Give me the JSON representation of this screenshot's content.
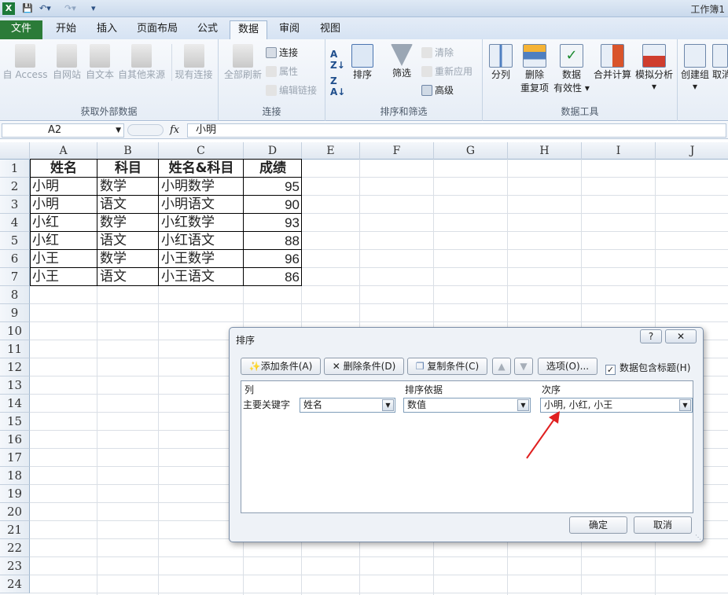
{
  "titlebar": {
    "icons": [
      "excel-logo-icon",
      "save-icon",
      "undo-icon",
      "redo-icon",
      "customize-icon"
    ],
    "title": "工作簿1"
  },
  "tabs": [
    "文件",
    "开始",
    "插入",
    "页面布局",
    "公式",
    "数据",
    "审阅",
    "视图"
  ],
  "active_tab": "数据",
  "ribbon": {
    "groups": {
      "external": {
        "label": "获取外部数据",
        "buttons": [
          "自 Access",
          "自网站",
          "自文本",
          "自其他来源",
          "现有连接"
        ]
      },
      "connections": {
        "label": "连接",
        "refresh_all": "全部刷新",
        "items": [
          "连接",
          "属性",
          "编辑链接"
        ]
      },
      "sort_filter": {
        "label": "排序和筛选",
        "sort": "排序",
        "filter": "筛选",
        "items": [
          "清除",
          "重新应用",
          "高级"
        ]
      },
      "data_tools": {
        "label": "数据工具",
        "buttons": [
          "分列",
          "删除",
          "重复项",
          "数据",
          "有效性",
          "合并计算",
          "模拟分析"
        ]
      },
      "outline": {
        "buttons": [
          "创建组",
          "取消"
        ]
      }
    }
  },
  "formula_bar": {
    "name_box": "A2",
    "fx_label": "fx",
    "value": "小明"
  },
  "sheet": {
    "columns": [
      "A",
      "B",
      "C",
      "D",
      "E",
      "F",
      "G",
      "H",
      "I",
      "J"
    ],
    "rows": [
      "1",
      "2",
      "3",
      "4",
      "5",
      "6",
      "7",
      "8",
      "9",
      "10",
      "11",
      "12",
      "13",
      "14",
      "15",
      "16",
      "17",
      "18",
      "19",
      "20",
      "21",
      "22",
      "23",
      "24"
    ],
    "header": [
      "姓名",
      "科目",
      "姓名&科目",
      "成绩"
    ],
    "data": [
      [
        "小明",
        "数学",
        "小明数学",
        "95"
      ],
      [
        "小明",
        "语文",
        "小明语文",
        "90"
      ],
      [
        "小红",
        "数学",
        "小红数学",
        "93"
      ],
      [
        "小红",
        "语文",
        "小红语文",
        "88"
      ],
      [
        "小王",
        "数学",
        "小王数学",
        "96"
      ],
      [
        "小王",
        "语文",
        "小王语文",
        "86"
      ]
    ]
  },
  "dialog": {
    "title": "排序",
    "help": "?",
    "add": "添加条件(A)",
    "delete": "删除条件(D)",
    "copy": "复制条件(C)",
    "options": "选项(O)...",
    "has_header": "数据包含标题(H)",
    "has_header_checked": true,
    "col_header": "列",
    "sort_on_header": "排序依据",
    "order_header": "次序",
    "row_label": "主要关键字",
    "column_value": "姓名",
    "sort_on_value": "数值",
    "order_value": "小明, 小红, 小王",
    "ok": "确定",
    "cancel": "取消"
  }
}
